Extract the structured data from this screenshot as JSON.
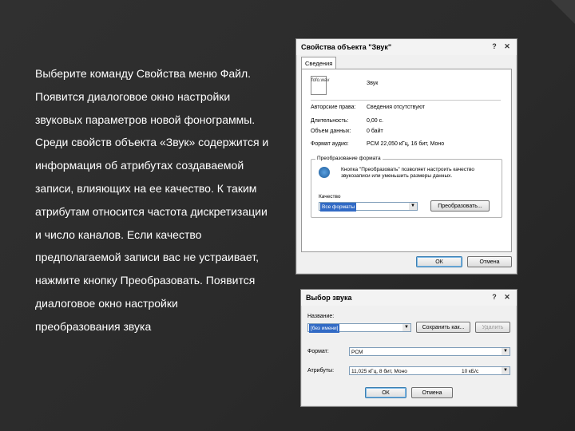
{
  "slide": {
    "lines": [
      "Выберите команду Свойства меню Файл.",
      "Появится диалоговое окно настройки",
      "звуковых параметров новой фонограммы.",
      "Среди свойств объекта «Звук» содержится и",
      "информация об атрибутах создаваемой",
      "записи, влияющих на ее качество. К таким",
      "атрибутам относится частота дискретизации",
      "и число каналов. Если качество",
      "предполагаемой записи вас не устраивает,",
      "нажмите кнопку Преобразовать. Появится",
      "диалоговое окно настройки",
      "преобразования звука"
    ]
  },
  "properties_dialog": {
    "title": "Свойства объекта \"Звук\"",
    "help": "?",
    "close": "✕",
    "tab": "Сведения",
    "icon_text": "fofo.wav",
    "icon_name": "Звук",
    "rows": [
      {
        "label": "Авторские права:",
        "value": "Сведения отсутствуют"
      },
      {
        "label": "Длительность:",
        "value": "0,00 с."
      },
      {
        "label": "Объем данных:",
        "value": "0 байт"
      },
      {
        "label": "Формат аудио:",
        "value": "PCM 22,050 кГц, 16 бит, Моно"
      }
    ],
    "group_title": "Преобразование формата",
    "group_text": "Кнопка \"Преобразовать\" позволяет настроить качество звукозаписи или уменьшить размеры данных.",
    "quality_label": "Качество",
    "quality_value": "Все форматы",
    "convert_button": "Преобразовать...",
    "ok_button": "ОК",
    "cancel_button": "Отмена"
  },
  "sound_dialog": {
    "title": "Выбор звука",
    "help": "?",
    "close": "✕",
    "name_label": "Название:",
    "name_value": "[без имени]",
    "save_as_button": "Сохранить как...",
    "delete_button": "Удалить",
    "format_label": "Формат:",
    "format_value": "PCM",
    "attributes_label": "Атрибуты:",
    "attributes_value": "11,025 кГц, 8 бит, Моно",
    "attributes_rate": "10 кБ/с",
    "ok_button": "ОК",
    "cancel_button": "Отмена"
  },
  "arrow_glyph": "▼"
}
